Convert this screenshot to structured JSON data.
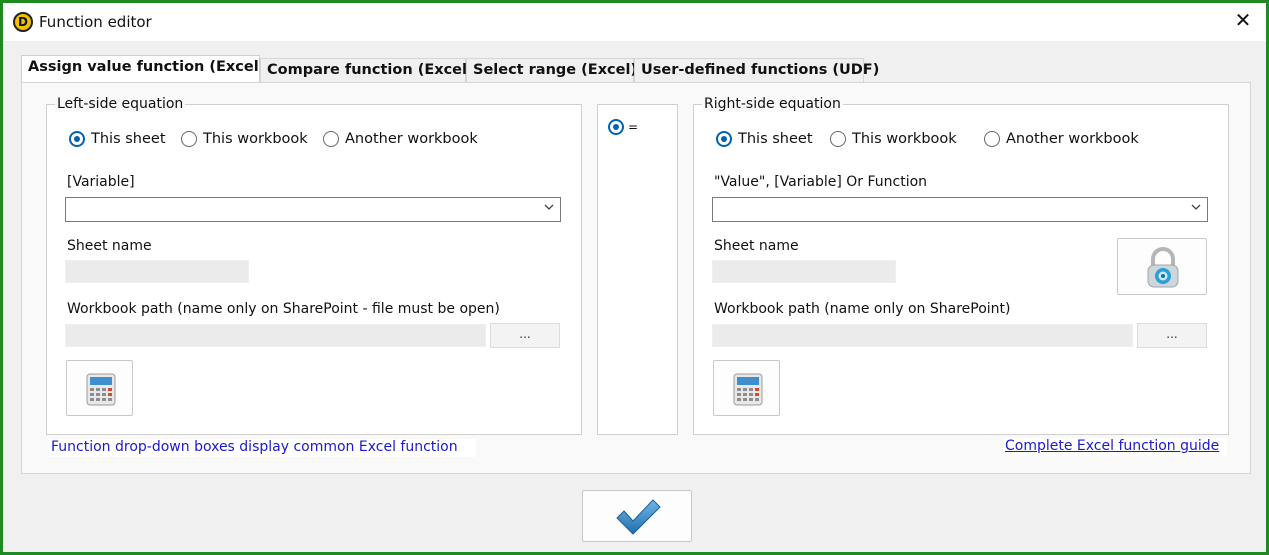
{
  "window": {
    "title": "Function editor",
    "app_icon_letter": "D",
    "close_glyph": "✕",
    "border_color": "#1f8a1f"
  },
  "tabs": [
    {
      "label": "Assign value function (Excel)",
      "active": true
    },
    {
      "label": "Compare function (Excel)",
      "active": false
    },
    {
      "label": "Select range (Excel)",
      "active": false
    },
    {
      "label": "User-defined functions (UDF)",
      "active": false
    }
  ],
  "left": {
    "group_label": "Left-side equation",
    "radios": [
      {
        "label": "This sheet",
        "checked": true
      },
      {
        "label": "This workbook",
        "checked": false
      },
      {
        "label": "Another workbook",
        "checked": false
      }
    ],
    "variable_label": "[Variable]",
    "variable_value": "",
    "sheet_label": "Sheet name",
    "sheet_value": "",
    "path_label": "Workbook path (name only on SharePoint - file must be open)",
    "path_value": "",
    "browse_label": "...",
    "calc_icon": "calculator-icon"
  },
  "middle": {
    "operator_label": "=",
    "checked": true
  },
  "right": {
    "group_label": "Right-side equation",
    "radios": [
      {
        "label": "This sheet",
        "checked": true
      },
      {
        "label": "This workbook",
        "checked": false
      },
      {
        "label": "Another workbook",
        "checked": false
      }
    ],
    "value_label": "\"Value\", [Variable] Or Function",
    "value_value": "",
    "sheet_label": "Sheet name",
    "sheet_value": "",
    "path_label": "Workbook path (name only on SharePoint)",
    "path_value": "",
    "browse_label": "...",
    "calc_icon": "calculator-icon",
    "lock_icon": "padlock-icon"
  },
  "footer": {
    "left_note": "Function drop-down boxes display common Excel function",
    "right_link": "Complete Excel function guide",
    "ok_icon": "checkmark-icon"
  },
  "colors": {
    "accent": "#0063b1",
    "link": "#1a1acc",
    "check": "#2b86c8"
  }
}
